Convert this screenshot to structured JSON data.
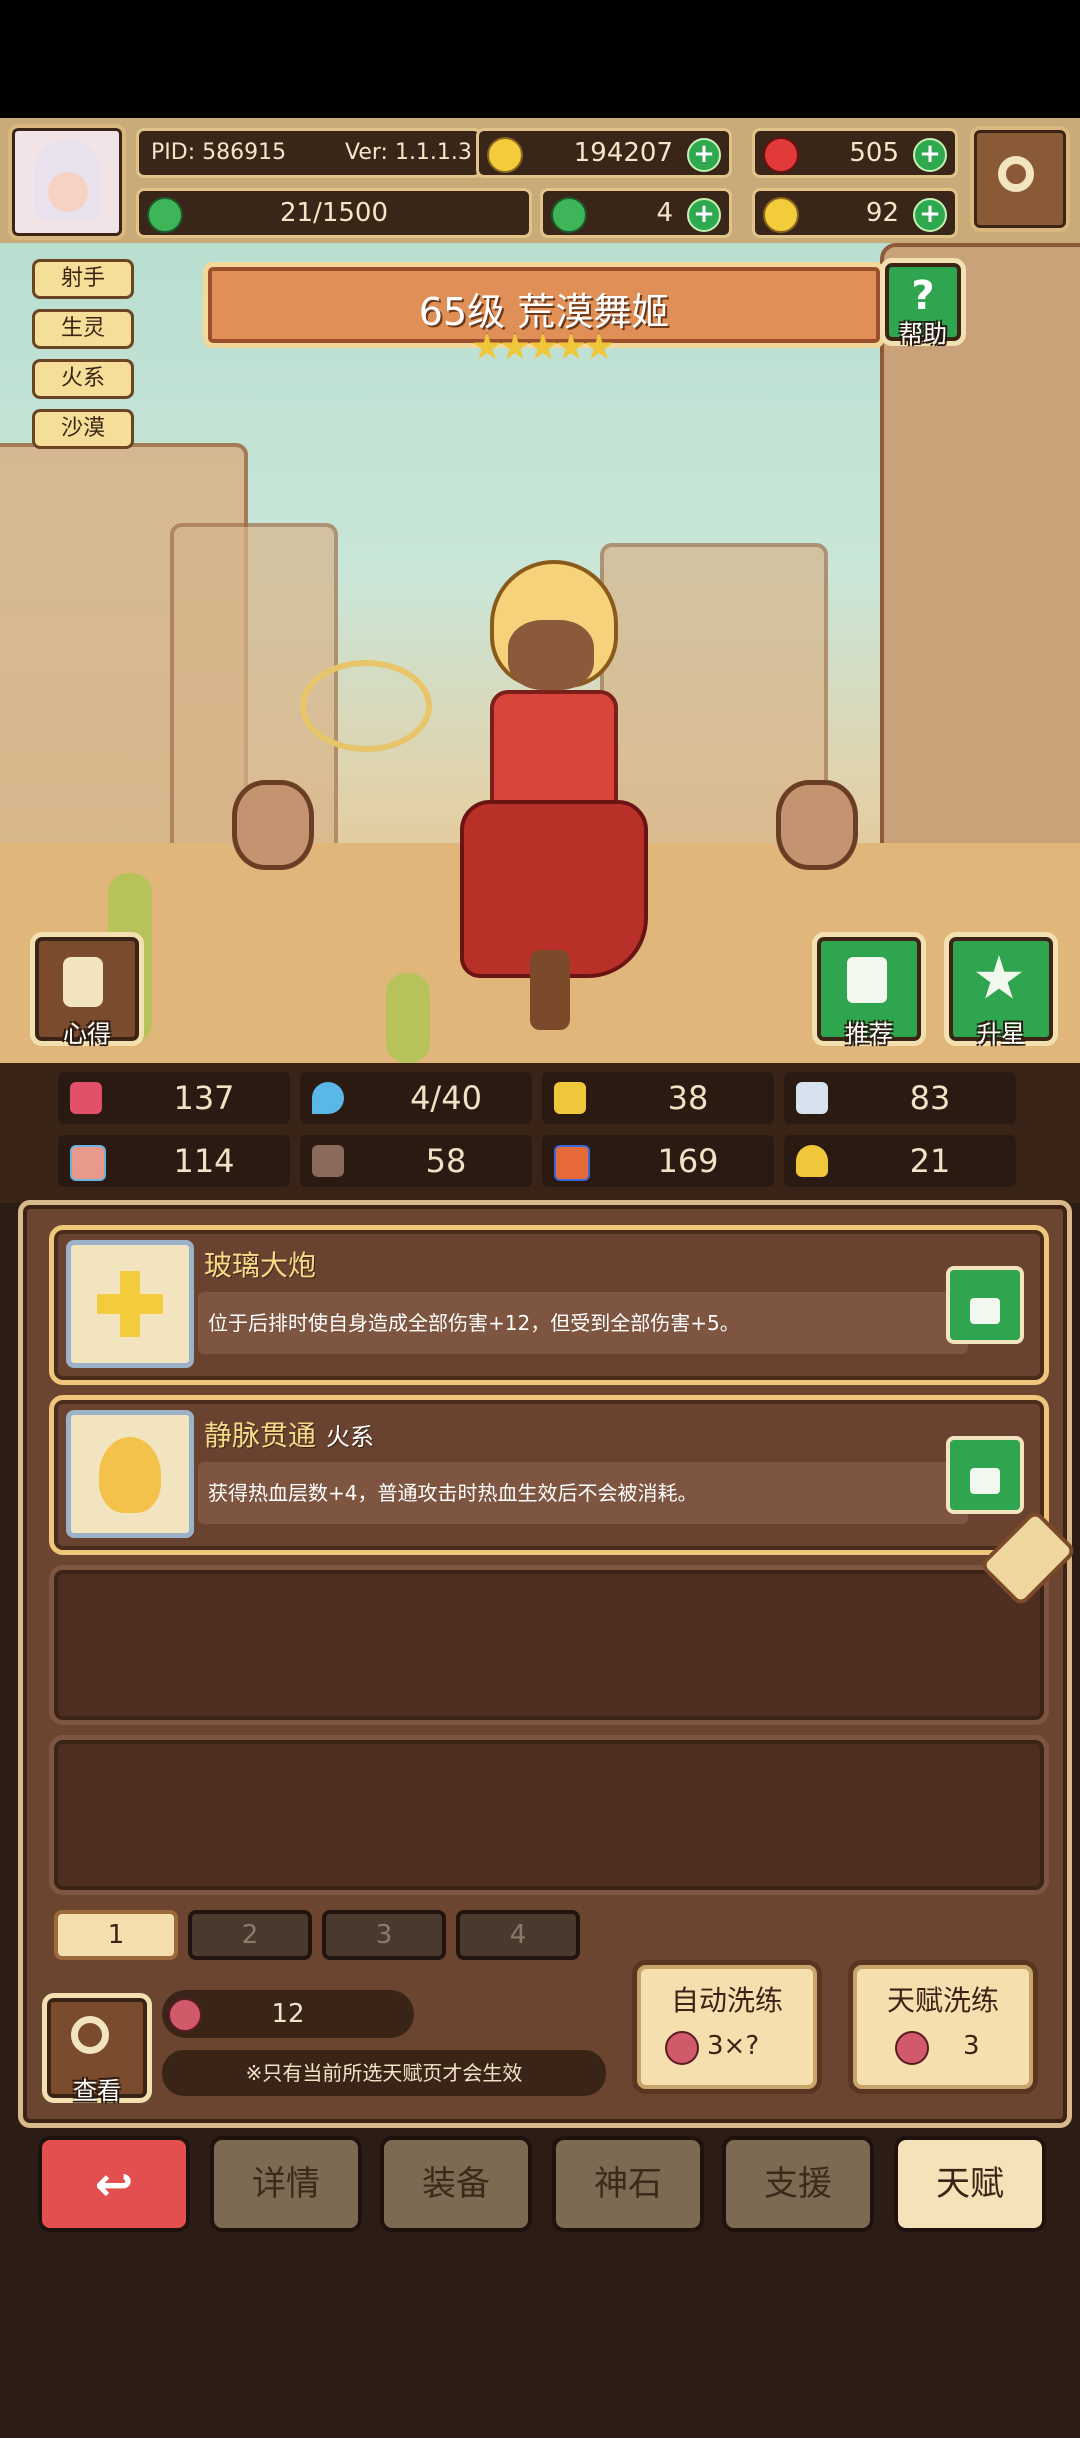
{
  "header": {
    "pid": "PID: 586915",
    "version": "Ver: 1.1.1.3",
    "gold": "194207",
    "gems": "505",
    "exp": "21/1500",
    "clover": "4",
    "tokens": "92"
  },
  "hero": {
    "tags": [
      "射手",
      "生灵",
      "火系",
      "沙漠"
    ],
    "title": "65级  荒漠舞姬",
    "stars": 5,
    "help_label": "帮助",
    "heart_label": "心得",
    "recommend_label": "推荐",
    "upgrade_label": "升星"
  },
  "stats": [
    {
      "icon": "heart-icon",
      "value": "137"
    },
    {
      "icon": "drop-icon",
      "value": "4/40"
    },
    {
      "icon": "shield-icon",
      "value": "38"
    },
    {
      "icon": "wing-icon",
      "value": "83"
    },
    {
      "icon": "fist-icon",
      "value": "114"
    },
    {
      "icon": "book-icon",
      "value": "58"
    },
    {
      "icon": "flag-icon",
      "value": "169"
    },
    {
      "icon": "horseshoe-icon",
      "value": "21"
    }
  ],
  "talents": [
    {
      "name": "玻璃大炮",
      "sub": "",
      "desc": "位于后排时使自身造成全部伤害+12，但受到全部伤害+5。"
    },
    {
      "name": "静脉贯通",
      "sub": "火系",
      "desc": "获得热血层数+4，普通攻击时热血生效后不会被消耗。"
    }
  ],
  "pages": [
    "1",
    "2",
    "3",
    "4"
  ],
  "footer": {
    "view_label": "查看",
    "fruit_count": "12",
    "note": "※只有当前所选天赋页才会生效",
    "auto_wash_label": "自动洗练",
    "auto_wash_cost": "3×?",
    "wash_label": "天赋洗练",
    "wash_cost": "3"
  },
  "bottom_nav": [
    "详情",
    "装备",
    "神石",
    "支援",
    "天赋"
  ]
}
